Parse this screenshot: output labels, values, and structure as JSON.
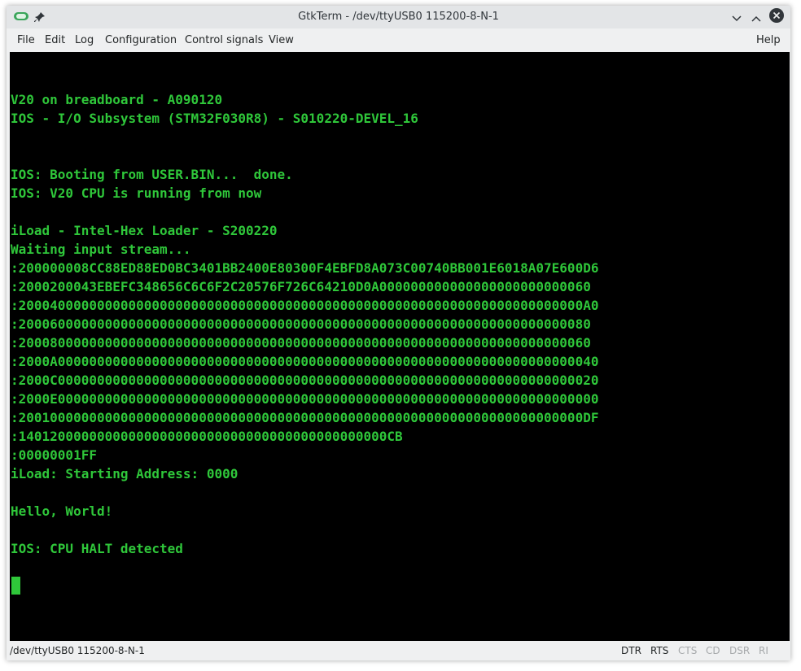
{
  "window": {
    "title": "GtkTerm - /dev/ttyUSB0 115200-8-N-1",
    "icons": [
      "app-icon",
      "pin-icon",
      "minimize-icon",
      "maximize-icon",
      "close-icon"
    ]
  },
  "menu": {
    "file": "File",
    "edit": "Edit",
    "log": "Log",
    "configuration": "Configuration",
    "control_signals": "Control signals",
    "view": "View",
    "help": "Help"
  },
  "terminal": {
    "text_color": "#2fc73a",
    "background": "#000000",
    "lines": [
      "V20 on breadboard - A090120",
      "IOS - I/O Subsystem (STM32F030R8) - S010220-DEVEL_16",
      "IOS: Booting from USER.BIN...  done.",
      "IOS: V20 CPU is running from now",
      "iLoad - Intel-Hex Loader - S200220",
      "Waiting input stream...",
      ":200000008CC88ED88ED0BC3401BB2400E80300F4EBFD8A073C00740BB001E6018A07E600D6",
      ":2000200043EBEFC348656C6C6F2C20576F726C64210D0A000000000000000000000000060",
      ":200040000000000000000000000000000000000000000000000000000000000000000000A0",
      ":2000600000000000000000000000000000000000000000000000000000000000000000080",
      ":2000800000000000000000000000000000000000000000000000000000000000000000060",
      ":2000A000000000000000000000000000000000000000000000000000000000000000000040",
      ":2000C000000000000000000000000000000000000000000000000000000000000000000020",
      ":2000E000000000000000000000000000000000000000000000000000000000000000000000",
      ":200100000000000000000000000000000000000000000000000000000000000000000000DF",
      ":14012000000000000000000000000000000000000000000CB",
      ":00000001FF",
      "iLoad: Starting Address: 0000",
      "Hello, World!",
      "IOS: CPU HALT detected"
    ]
  },
  "status": {
    "port": "/dev/ttyUSB0  115200-8-N-1",
    "signals": [
      {
        "label": "DTR",
        "active": true
      },
      {
        "label": "RTS",
        "active": true
      },
      {
        "label": "CTS",
        "active": false
      },
      {
        "label": "CD",
        "active": false
      },
      {
        "label": "DSR",
        "active": false
      },
      {
        "label": "RI",
        "active": false
      }
    ]
  }
}
